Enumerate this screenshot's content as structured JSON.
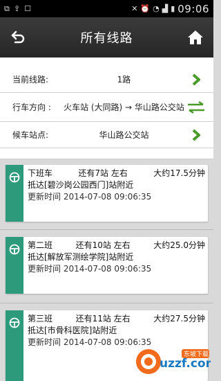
{
  "status_bar": {
    "time": "09:06"
  },
  "header": {
    "title": "所有线路"
  },
  "info": {
    "route_label": "当前线路:",
    "route_value": "1路",
    "direction_label": "行车方向 :",
    "direction_value": "火车站 (大同路) → 华山路公交站",
    "stop_label": "候车站点:",
    "stop_value": "华山路公交站"
  },
  "buses": [
    {
      "name": "下班车",
      "stops": "还有7站 左右",
      "eta": "大约17.5分钟",
      "arrive": "抵达[碧沙岗公园西门]站附近",
      "update": "更新时间 2014-07-08 09:06:35"
    },
    {
      "name": "第二班",
      "stops": "还有10站 左右",
      "eta": "大约25.0分钟",
      "arrive": "抵达[解放军测绘学院]站附近",
      "update": "更新时间 2014-07-08 09:06:35"
    },
    {
      "name": "第三班",
      "stops": "还有11站 左右",
      "eta": "大约27.5分钟",
      "arrive": "抵达[市骨科医院]站附近",
      "update": "更新时间 2014-07-08 09:06:35"
    }
  ],
  "watermark": {
    "text": "uzzf.com",
    "badge": "东坡下载"
  },
  "colors": {
    "accent_green": "#2e9a7c",
    "arrow_green": "#4a9a2a"
  }
}
